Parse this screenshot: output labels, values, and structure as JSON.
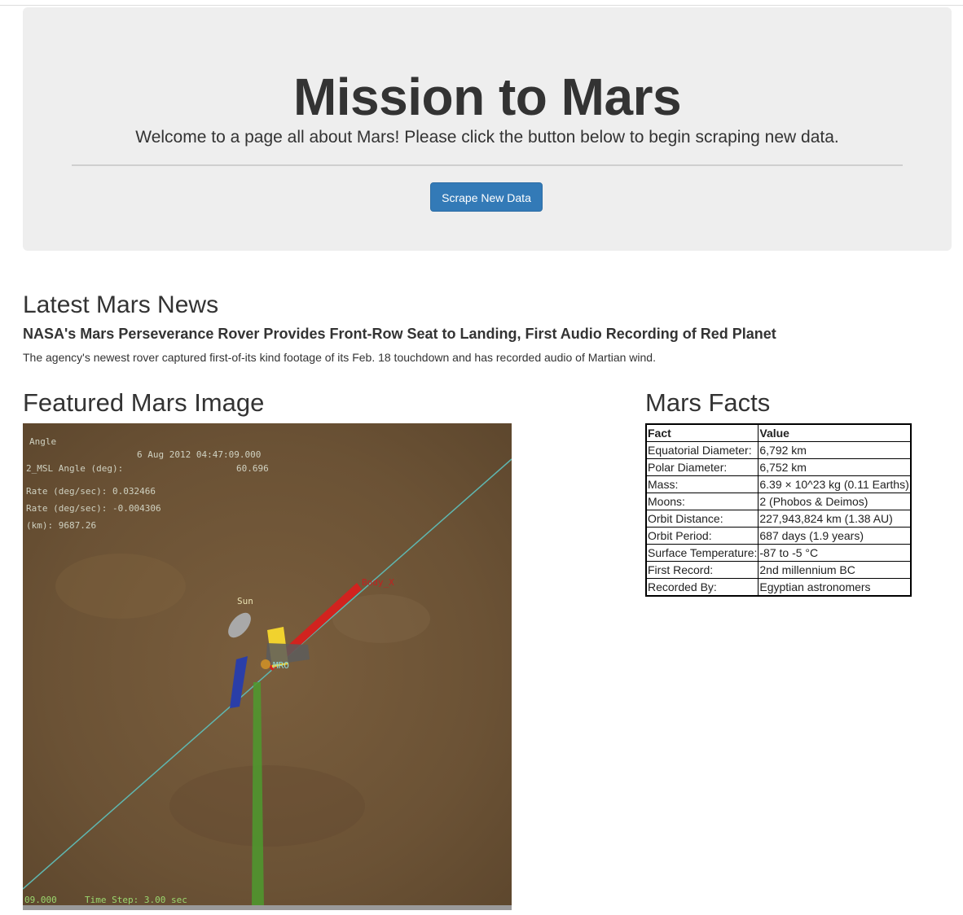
{
  "header": {
    "title": "Mission to Mars",
    "lead": "Welcome to a page all about Mars! Please click the button below to begin scraping new data.",
    "button_label": "Scrape New Data",
    "button_color": "#337ab7"
  },
  "news": {
    "heading": "Latest Mars News",
    "title": "NASA's Mars Perseverance Rover Provides Front-Row Seat to Landing, First Audio Recording of Red Planet",
    "paragraph": "The agency's newest rover captured first-of-its kind footage of its Feb. 18 touchdown and has recorded audio of Martian wind."
  },
  "featured": {
    "heading": "Featured Mars Image",
    "image": {
      "description_icon": "mars-featured-image",
      "overlay_text": {
        "line1": "Angle",
        "line2": "6 Aug 2012 04:47:09.000",
        "line3": "2_MSL Angle (deg):",
        "line3_value": "60.696",
        "line4": "Rate (deg/sec):  0.032466",
        "line5": "Rate (deg/sec): -0.004306",
        "line6": "(km): 9687.26",
        "label_sun": "Sun",
        "label_body": "Body_X",
        "label_mro": "MRO",
        "bottom_left": "09.000",
        "bottom_step": "Time Step: 3.00 sec"
      }
    }
  },
  "facts": {
    "heading": "Mars Facts",
    "columns": [
      "Fact",
      "Value"
    ],
    "rows": [
      [
        "Equatorial Diameter:",
        "6,792 km"
      ],
      [
        "Polar Diameter:",
        "6,752 km"
      ],
      [
        "Mass:",
        "6.39 × 10^23 kg (0.11 Earths)"
      ],
      [
        "Moons:",
        "2 (Phobos & Deimos)"
      ],
      [
        "Orbit Distance:",
        "227,943,824 km (1.38 AU)"
      ],
      [
        "Orbit Period:",
        "687 days (1.9 years)"
      ],
      [
        "Surface Temperature:",
        "-87 to -5 °C"
      ],
      [
        "First Record:",
        "2nd millennium BC"
      ],
      [
        "Recorded By:",
        "Egyptian astronomers"
      ]
    ]
  }
}
